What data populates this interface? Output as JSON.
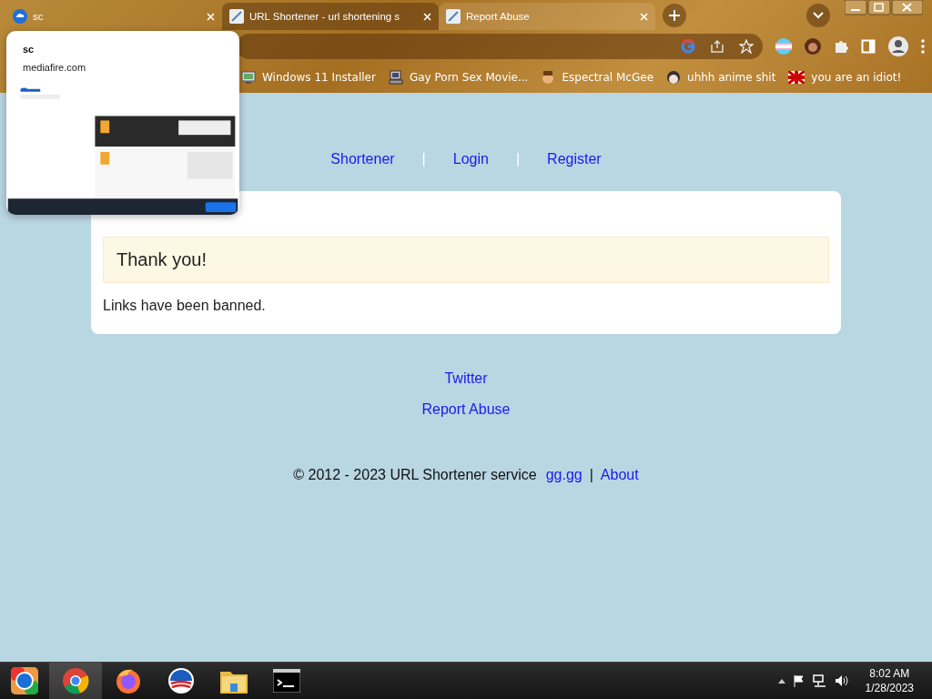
{
  "browser": {
    "tabs": [
      {
        "title": "sc",
        "kind": "cloud",
        "selected": false,
        "hovered": false
      },
      {
        "title": "URL Shortener - url shortening s",
        "kind": "link",
        "selected": false,
        "hovered": true
      },
      {
        "title": "Report Abuse",
        "kind": "link",
        "selected": true,
        "hovered": false
      }
    ],
    "bookmarks": [
      {
        "label": "Windows 11 Installer",
        "kind": "monitor"
      },
      {
        "label": "Gay Porn Sex Movie...",
        "kind": "computer"
      },
      {
        "label": "Espectral McGee",
        "kind": "face"
      },
      {
        "label": "uhhh anime shit",
        "kind": "anime"
      },
      {
        "label": "you are an idiot!",
        "kind": "flag"
      }
    ]
  },
  "tab_preview": {
    "title": "sc",
    "url": "mediafire.com"
  },
  "page": {
    "nav": [
      {
        "label": "Shortener"
      },
      {
        "label": "Login"
      },
      {
        "label": "Register"
      }
    ],
    "nav_separator": "|",
    "card": {
      "alert": "Thank you!",
      "message": "Links have been banned."
    },
    "footer_links": [
      {
        "label": "Twitter"
      },
      {
        "label": "Report Abuse"
      }
    ],
    "copyright": {
      "text": "© 2012 - 2023 URL Shortener service",
      "links": [
        {
          "label": "gg.gg"
        },
        {
          "label": "About"
        }
      ],
      "separator": "|"
    }
  },
  "taskbar": {
    "apps": [
      {
        "kind": "start",
        "selected": false
      },
      {
        "kind": "chrome",
        "selected": true
      },
      {
        "kind": "firefox",
        "selected": false
      },
      {
        "kind": "campaign",
        "selected": false
      },
      {
        "kind": "folder",
        "selected": false
      },
      {
        "kind": "terminal",
        "selected": false
      }
    ],
    "clock": {
      "time": "8:02 AM",
      "date": "1/28/2023"
    }
  }
}
